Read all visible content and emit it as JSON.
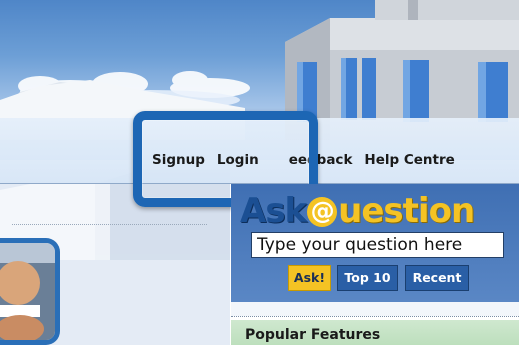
{
  "nav": {
    "signup": "Signup",
    "login": "Login",
    "feedback": "eedback",
    "help_centre": "Help Centre"
  },
  "ask_box": {
    "logo_ask": "Ask",
    "logo_at": "@",
    "logo_question": "uestion",
    "input_value": "Type your question here",
    "ask_button": "Ask!",
    "top10_button": "Top 10",
    "recent_button": "Recent"
  },
  "sidebar": {
    "popular_title": "Popular Features"
  },
  "colors": {
    "highlight_border": "#1d66b4",
    "ask_button_bg": "#f4c324",
    "nav_button_bg": "#2a5fa6",
    "popular_bg": "#c8e4c8"
  }
}
